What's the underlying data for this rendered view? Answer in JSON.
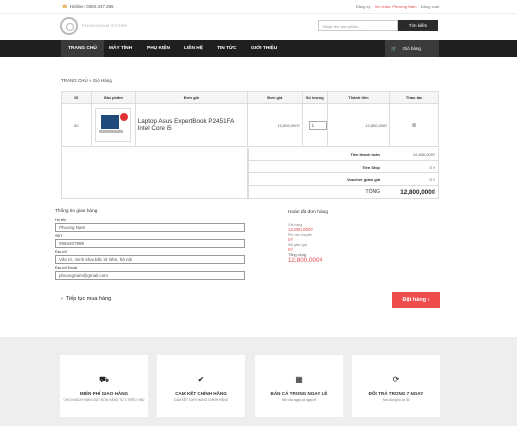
{
  "topbar": {
    "hotline": "Hotline: 0394.347.285",
    "links": [
      "Đăng ký",
      "Xin chào: Phương Nam",
      "Đăng xuất"
    ]
  },
  "header": {
    "logo_text": "PHONGNAM STORE",
    "search_placeholder": "Nhập tên sản phẩm...",
    "search_button": "Tìm kiếm"
  },
  "nav": {
    "items": [
      "TRANG CHỦ",
      "MÁY TÍNH",
      "PHỤ KIỆN",
      "LIÊN HỆ",
      "TIN TỨC",
      "GIỚI THIỆU"
    ],
    "active_index": 0,
    "cart_label": "Giỏ hàng"
  },
  "breadcrumb": "TRANG CHỦ » Giỏ Hàng",
  "cart_table": {
    "headers": [
      "ID",
      "Sản phẩm",
      "Đơn giá",
      "Đơn giá",
      "Số lượng",
      "Thành tiền",
      "Thao tác"
    ],
    "rows": [
      {
        "id": "82",
        "name": "Laptop Asus ExpertBook P2451FA Intel Core i5",
        "unit_price": "12,800,000₫",
        "quantity": "1",
        "subtotal": "12,800,000₫",
        "action_icon": "remove-circle-icon"
      }
    ]
  },
  "summary": {
    "rows": [
      {
        "label": "Tiền thanh toán",
        "value": "12,800,000₫"
      },
      {
        "label": "Tiền Ship",
        "value": "0 ₫"
      },
      {
        "label": "Voucher giảm giá",
        "value": "0 ₫"
      }
    ],
    "total_label": "TỔNG",
    "total_value": "12,800,000₫"
  },
  "shipping": {
    "title": "Thông tin giao hàng",
    "fields": [
      {
        "label": "Họ tên",
        "value": "Phuong Nam"
      },
      {
        "label": "SĐT",
        "value": "0983407999"
      },
      {
        "label": "Địa chỉ",
        "value": "Văn tri, minh khai,bắc từ liêm, hà nội"
      },
      {
        "label": "Địa chỉ Email",
        "value": "phuongnam@gmail.com"
      }
    ]
  },
  "order_done": {
    "title": "Hoàn tất đơn hàng",
    "lines": [
      {
        "label": "Giá hàng",
        "value": "12,800,000₫"
      },
      {
        "label": "Phí vận chuyển",
        "value": "0₫"
      },
      {
        "label": "Mã giảm giá",
        "value": "0₫"
      }
    ],
    "total_label": "Tổng cộng",
    "total_value": "12,800,000₫"
  },
  "actions": {
    "continue_shopping": "Tiếp tục mua hàng",
    "order_button": "Đặt hàng"
  },
  "footer": {
    "features": [
      {
        "icon": "truck-icon",
        "glyph": "⛟",
        "title": "MIỄN PHÍ GIAO HÀNG",
        "desc": "CHO KHÁCH HÀNG ĐẠT ĐƠN HÀNG TỪ 3 TRIỆU VND"
      },
      {
        "icon": "check-icon",
        "glyph": "✔",
        "title": "CAM KẾT CHÍNH HÃNG",
        "desc": "CAM KẾT 100% HÀNG CHÍNH HÃNG"
      },
      {
        "icon": "calendar-icon",
        "glyph": "▦",
        "title": "BÁN CẢ TRONG NGAY LỄ",
        "desc": "Mở cửa ngày cả ngày lễ"
      },
      {
        "icon": "refresh-icon",
        "glyph": "⟳",
        "title": "ĐỔI TRẢ TRONG 7 NGAY",
        "desc": "Nếu đồng bộ có lỗi"
      }
    ]
  },
  "colors": {
    "nav_bg": "#1f1f1f",
    "accent_red": "#ef4d4d",
    "footer_bg": "#eeeeee"
  }
}
